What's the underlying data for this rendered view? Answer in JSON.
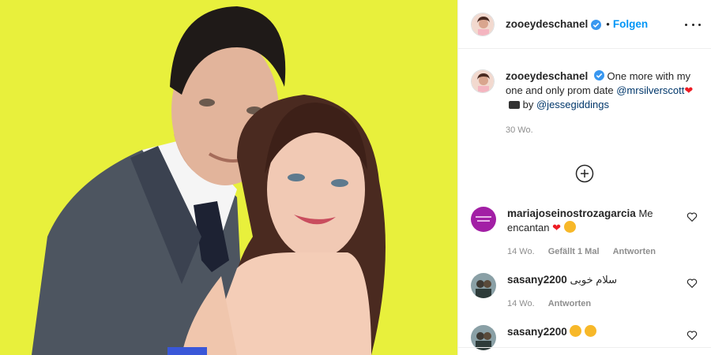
{
  "post": {
    "author": "zooeydeschanel",
    "follow_label": "Folgen",
    "dot": "•",
    "caption": {
      "text": "One more with my one and only prom date",
      "mention1": "@mrsilverscott",
      "by_label": "by",
      "mention2": "@jessegiddings"
    },
    "timestamp": "30 Wo."
  },
  "comments": [
    {
      "user": "mariajoseinostrozagarcia",
      "text": "Me encantan",
      "time": "14 Wo.",
      "likes": "Gefällt 1 Mal",
      "reply": "Antworten"
    },
    {
      "user": "sasany2200",
      "text": "سلام خوبی",
      "time": "14 Wo.",
      "reply": "Antworten"
    },
    {
      "user": "sasany2200",
      "text": ""
    }
  ],
  "colors": {
    "photo_background": "#e6ef2a",
    "link": "#0095f6",
    "verified": "#3897f0",
    "muted": "#8e8e8e"
  },
  "icons": {
    "verified": "verified-badge-icon",
    "more": "more-options-icon",
    "load_more": "plus-circle-icon",
    "like": "heart-outline-icon"
  }
}
